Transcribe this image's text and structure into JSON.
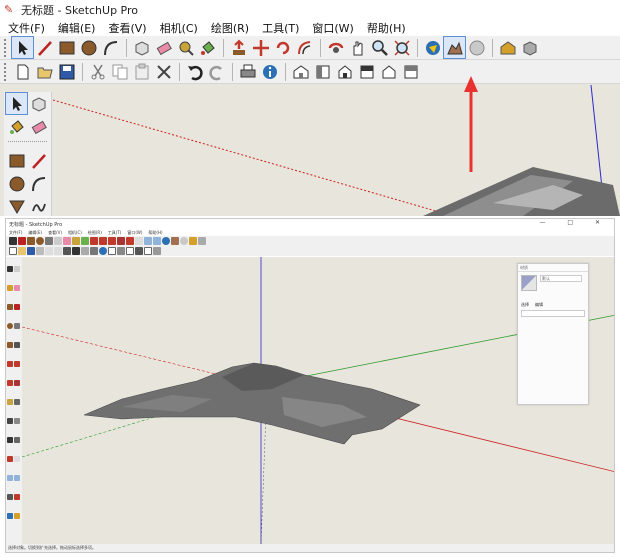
{
  "top_panel": {
    "window_title": "无标题 - SketchUp Pro",
    "menu": [
      "文件(F)",
      "编辑(E)",
      "查看(V)",
      "相机(C)",
      "绘图(R)",
      "工具(T)",
      "窗口(W)",
      "帮助(H)"
    ],
    "toolbar_row1": [
      "select-icon",
      "line-icon",
      "rectangle-icon",
      "circle-icon",
      "arc-icon",
      "make-component-icon",
      "eraser-icon",
      "tape-measure-icon",
      "paint-bucket-icon",
      "push-pull-icon",
      "move-icon",
      "rotate-icon",
      "offset-icon",
      "orbit-icon",
      "pan-icon",
      "zoom-icon",
      "zoom-extents-icon",
      "add-location-icon",
      "toggle-terrain-icon",
      "photo-textures-icon",
      "warehouse-icon",
      "extension-warehouse-icon"
    ],
    "toolbar_row2": [
      "new-icon",
      "open-icon",
      "save-icon",
      "cut-icon",
      "copy-icon",
      "paste-icon",
      "erase-icon",
      "undo-icon",
      "redo-icon",
      "print-icon",
      "model-info-icon",
      "iso-view-icon",
      "top-view-icon",
      "front-view-icon",
      "right-view-icon",
      "back-view-icon",
      "left-view-icon"
    ],
    "highlighted_tool": "toggle-terrain-icon",
    "arrow_color": "#e8322f"
  },
  "bottom_panel": {
    "window_title": "无标题 - SketchUp Pro",
    "window_controls": "— □ ✕",
    "menu": [
      "文件(F)",
      "编辑(E)",
      "查看(V)",
      "相机(C)",
      "绘图(R)",
      "工具(T)",
      "窗口(W)",
      "帮助(H)"
    ],
    "tray": {
      "title": "材质",
      "material_name": "默认",
      "tabs": [
        "选择",
        "编辑"
      ]
    },
    "status_text": "选择对象。切换到扩充选择。拖动鼠标选择多项。"
  },
  "colors": {
    "canvas": "#e8e5dc",
    "axis_red": "#cc2222",
    "axis_green": "#2e9a2e",
    "axis_blue": "#2a2acc"
  }
}
